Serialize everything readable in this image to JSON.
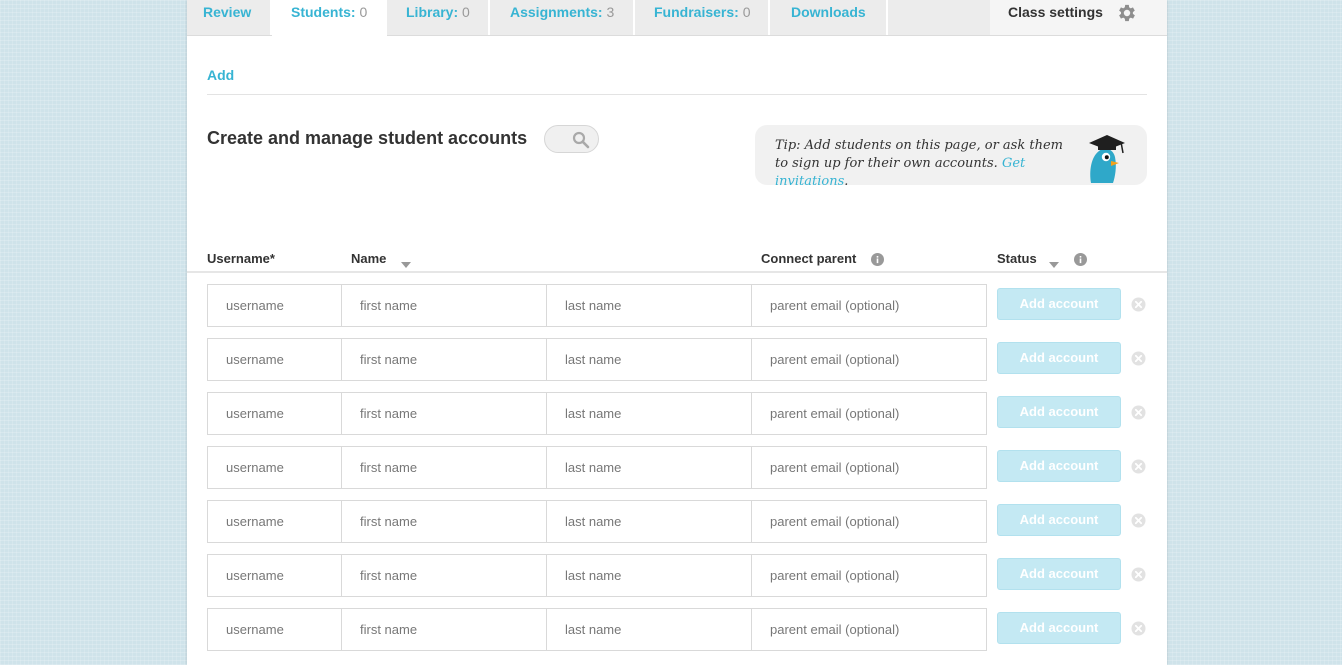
{
  "tabs": [
    {
      "label": "Review",
      "count": ""
    },
    {
      "label": "Students:",
      "count": " 0"
    },
    {
      "label": "Library:",
      "count": " 0"
    },
    {
      "label": "Assignments:",
      "count": " 3"
    },
    {
      "label": "Fundraisers:",
      "count": " 0"
    },
    {
      "label": "Downloads",
      "count": ""
    }
  ],
  "active_tab": "Students",
  "settings_label": "Class settings",
  "add_link": "Add",
  "page_title": "Create and manage student accounts",
  "tip": {
    "text": "Tip: Add students on this page, or ask them to sign up for their own accounts. ",
    "link": "Get invitations",
    "end": "."
  },
  "columns": {
    "username": "Username*",
    "name": "Name",
    "connect_parent": "Connect parent",
    "status": "Status"
  },
  "row_placeholders": {
    "username": "username",
    "first_name": "first name",
    "last_name": "last name",
    "parent_email": "parent email (optional)"
  },
  "add_account_label": "Add account",
  "row_count": 7,
  "colors": {
    "accent": "#37b4d3",
    "button_disabled": "#c4e9f3",
    "background": "#cfe3ea",
    "bird": "#2fa8c9"
  },
  "icons": {
    "settings": "gear-icon",
    "search": "search-icon",
    "mascot": "bird-graduate-icon",
    "sort": "caret-down-icon",
    "info": "info-icon",
    "remove": "remove-circle-icon"
  }
}
